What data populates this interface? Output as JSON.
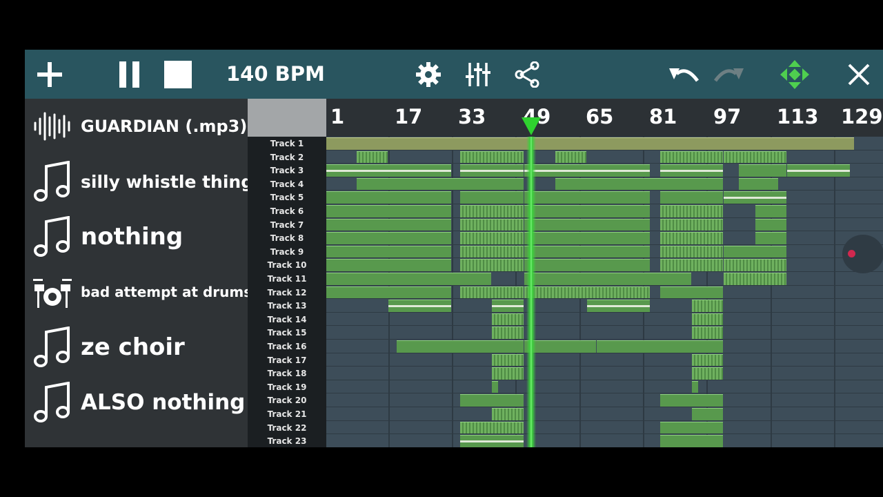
{
  "toolbar": {
    "icons": [
      "plus-icon",
      "pause-icon",
      "stop-icon",
      "gear-icon",
      "mixer-icon",
      "share-icon",
      "undo-icon",
      "redo-icon",
      "move-icon",
      "close-icon"
    ],
    "bpm": "140 BPM"
  },
  "instruments": [
    {
      "name": "GUARDIAN (.mp3)",
      "icon": "audio-waveform-icon"
    },
    {
      "name": "silly whistle thing",
      "icon": "music-note-icon"
    },
    {
      "name": "nothing",
      "icon": "music-note-icon"
    },
    {
      "name": "bad attempt at drums",
      "icon": "drum-kit-icon"
    },
    {
      "name": "ze choir",
      "icon": "music-note-icon"
    },
    {
      "name": "ALSO nothing",
      "icon": "music-note-icon"
    }
  ],
  "ruler": {
    "bars": [
      "1",
      "17",
      "33",
      "49",
      "65",
      "81",
      "97",
      "113",
      "129"
    ]
  },
  "tracks": [
    "Track 1",
    "Track 2",
    "Track 3",
    "Track 4",
    "Track 5",
    "Track 6",
    "Track 7",
    "Track 8",
    "Track 9",
    "Track 10",
    "Track 11",
    "Track 12",
    "Track 13",
    "Track 14",
    "Track 15",
    "Track 16",
    "Track 17",
    "Track 18",
    "Track 19",
    "Track 20",
    "Track 21",
    "Track 22",
    "Track 23"
  ],
  "colors": {
    "toolbar": "#29555f",
    "sidebar": "#2f3336",
    "clip": "#58994d",
    "playhead": "#2fd12f",
    "grid": "#3d4d59",
    "record": "#d1284f"
  }
}
